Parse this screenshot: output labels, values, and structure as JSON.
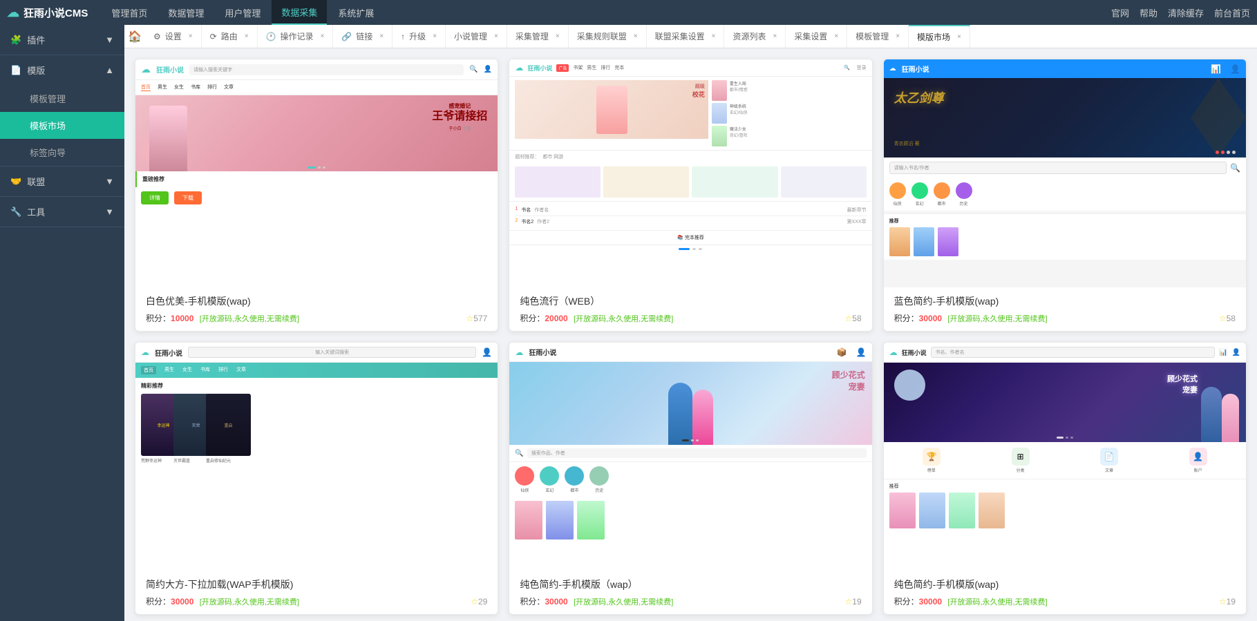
{
  "app": {
    "name": "狂雨小说CMS",
    "top_nav": {
      "items": [
        {
          "label": "管理首页",
          "active": false
        },
        {
          "label": "数据管理",
          "active": false
        },
        {
          "label": "用户管理",
          "active": false
        },
        {
          "label": "数据采集",
          "active": true
        },
        {
          "label": "系统扩展",
          "active": false
        }
      ],
      "right_items": [
        "官网",
        "帮助",
        "清除缓存",
        "前台首页"
      ]
    }
  },
  "tabs": [
    {
      "label": "🏠",
      "type": "home",
      "closable": false
    },
    {
      "label": "设置",
      "icon": "⚙",
      "closable": true
    },
    {
      "label": "路由",
      "icon": "🔗",
      "closable": true
    },
    {
      "label": "操作记录",
      "icon": "🕐",
      "closable": true
    },
    {
      "label": "链接",
      "icon": "🔗",
      "closable": true
    },
    {
      "label": "升级",
      "icon": "↑",
      "closable": true
    },
    {
      "label": "小说管理",
      "closable": true
    },
    {
      "label": "采集管理",
      "closable": true
    },
    {
      "label": "采集规则联盟",
      "closable": true
    },
    {
      "label": "联盟采集设置",
      "closable": true
    },
    {
      "label": "资源列表",
      "closable": true
    },
    {
      "label": "采集设置",
      "closable": true
    },
    {
      "label": "模板管理",
      "closable": true
    },
    {
      "label": "模板市场",
      "closable": true,
      "active": true
    }
  ],
  "sidebar": {
    "sections": [
      {
        "label": "插件",
        "icon": "🧩",
        "expanded": true,
        "items": []
      },
      {
        "label": "模版",
        "icon": "📄",
        "expanded": true,
        "items": [
          {
            "label": "模板管理",
            "active": false
          },
          {
            "label": "模板市场",
            "active": true
          },
          {
            "label": "标签向导",
            "active": false
          }
        ]
      },
      {
        "label": "联盟",
        "icon": "🤝",
        "expanded": true,
        "items": []
      },
      {
        "label": "工具",
        "icon": "🔧",
        "expanded": true,
        "items": []
      }
    ]
  },
  "templates": [
    {
      "id": 1,
      "title": "白色优美-手机模版(wap)",
      "score": 10000,
      "score_tag": "[开放源码,永久使用,无需续费]",
      "stars": 577,
      "type": "mobile",
      "preview_style": "white-mobile"
    },
    {
      "id": 2,
      "title": "纯色流行（WEB）",
      "score": 20000,
      "score_tag": "[开放源码,永久使用,无需续费]",
      "stars": 58,
      "type": "web",
      "preview_style": "pure-web"
    },
    {
      "id": 3,
      "title": "蓝色简约-手机模版(wap)",
      "score": 30000,
      "score_tag": "[开放源码,永久使用,无需续费]",
      "stars": 58,
      "type": "mobile",
      "preview_style": "blue-mobile"
    },
    {
      "id": 4,
      "title": "简约大方-下拉加载(WAP手机模版)",
      "score": 30000,
      "score_tag": "[开放源码,永久使用,无需续费]",
      "stars": 29,
      "type": "mobile",
      "preview_style": "simple-mobile"
    },
    {
      "id": 5,
      "title": "纯色简约-手机模版（wap）",
      "score": 30000,
      "score_tag": "[开放源码,永久使用,无需续费]",
      "stars": 19,
      "type": "mobile",
      "preview_style": "banner-mobile"
    },
    {
      "id": 6,
      "title": "纯色简约-手机模版(wap)",
      "score": 30000,
      "score_tag": "[开放源码,永久使用,无需续费]",
      "stars": 19,
      "type": "mobile",
      "preview_style": "couple-mobile"
    }
  ],
  "labels": {
    "score_prefix": "积分：",
    "detail_btn": "详情",
    "download_btn": "下载",
    "recommend_label": "完本推荐",
    "highlight_label": "精彩推荐",
    "book1": "荒野幸运神",
    "book2": "灭世霸蓝",
    "book3": "重启修仙纪元"
  }
}
